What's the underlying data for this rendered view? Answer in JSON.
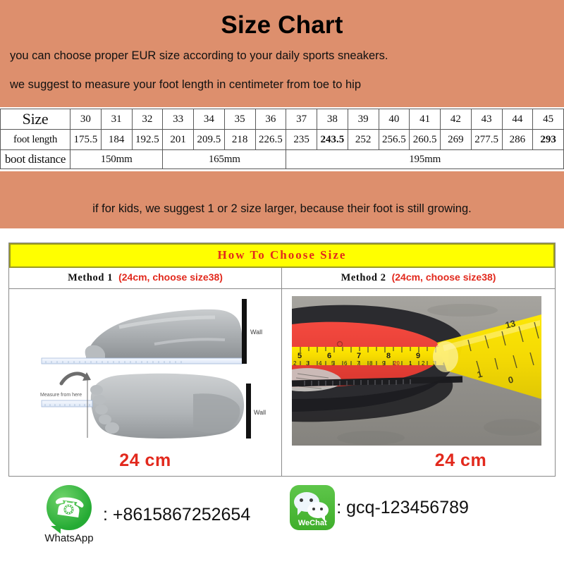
{
  "header": {
    "title": "Size Chart",
    "line1": "you can choose proper EUR size according to your daily sports sneakers.",
    "line2": "we suggest to measure your foot length in centimeter from toe to hip",
    "footnote": "if for kids, we suggest 1 or 2 size larger, because their foot is still growing.",
    "bg_color": "#dd8f6d"
  },
  "chart_data": {
    "type": "table",
    "title": "Size Chart",
    "row_labels": [
      "Size",
      "foot length",
      "boot distance"
    ],
    "categories": [
      "30",
      "31",
      "32",
      "33",
      "34",
      "35",
      "36",
      "37",
      "38",
      "39",
      "40",
      "41",
      "42",
      "43",
      "44",
      "45"
    ],
    "series": [
      {
        "name": "foot length",
        "values": [
          "175.5",
          "184",
          "192.5",
          "201",
          "209.5",
          "218",
          "226.5",
          "235",
          "243.5",
          "252",
          "256.5",
          "260.5",
          "269",
          "277.5",
          "286",
          "293"
        ],
        "bold_indices": [
          8,
          15
        ]
      }
    ],
    "boot_distance": [
      {
        "label": "150mm",
        "sizes": [
          "30",
          "31",
          "32"
        ],
        "span": 3
      },
      {
        "label": "165mm",
        "sizes": [
          "33",
          "34",
          "35",
          "36"
        ],
        "span": 4
      },
      {
        "label": "195mm",
        "sizes": [
          "37",
          "38",
          "39",
          "40",
          "41",
          "42",
          "43",
          "44",
          "45"
        ],
        "span": 9
      }
    ],
    "units": {
      "foot_length": "mm",
      "boot_distance": "mm"
    }
  },
  "chooser": {
    "banner": "How To Choose Size",
    "banner_bg": "#ffff00",
    "banner_color": "#e2291d",
    "methods": [
      {
        "heading": "Method 1",
        "note": "(24cm, choose size38)",
        "result": "24 cm",
        "labels": {
          "wall_top": "Wall",
          "wall_bottom": "Wall",
          "measure_from": "Measure from here"
        }
      },
      {
        "heading": "Method 2",
        "note": "(24cm, choose size38)",
        "result": "24 cm"
      }
    ]
  },
  "contacts": [
    {
      "app": "WhatsApp",
      "icon": "whatsapp-icon",
      "value": ": +8615867252654",
      "color": "#25ab34"
    },
    {
      "app": "WeChat",
      "icon": "wechat-icon",
      "value": ": gcq-123456789",
      "color": "#3fae2b"
    }
  ]
}
